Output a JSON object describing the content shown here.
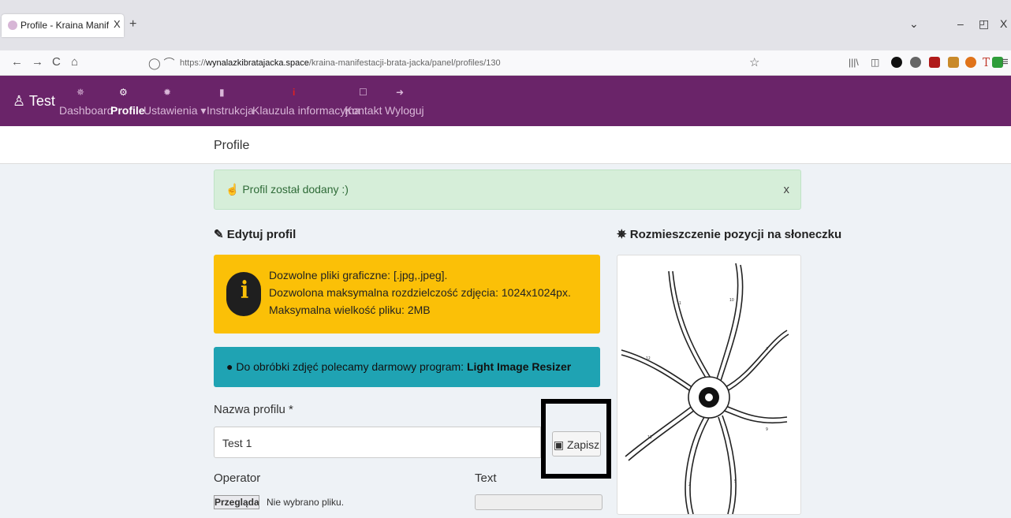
{
  "browser": {
    "tab_title": "Profile - Kraina Manifestacji Bra",
    "tab_close": "X",
    "new_tab": "+",
    "url_prefix": "https://",
    "url_domain": "wynalazkibratajacka.space",
    "url_path": "/kraina-manifestacji-brata-jacka/panel/profiles/130"
  },
  "appnav": {
    "brand": "Test",
    "items": [
      {
        "label": "Dashboard",
        "icon": "sun-icon"
      },
      {
        "label": "Profile",
        "icon": "cogs-icon"
      },
      {
        "label": "Ustawienia ▾",
        "icon": "gear-icon"
      },
      {
        "label": "Instrukcja",
        "icon": "file-icon"
      },
      {
        "label": "Klauzula informacyjna",
        "icon": "info-icon"
      },
      {
        "label": "Kontakt",
        "icon": "envelope-icon"
      },
      {
        "label": "Wyloguj",
        "icon": "logout-icon"
      }
    ]
  },
  "page": {
    "title": "Profile",
    "success_alert": "Profil został dodany :)",
    "success_close": "x",
    "edit_heading": "Edytuj profil",
    "sun_heading": "Rozmieszczenie pozycji na słoneczku",
    "warn_lines": [
      "Dozwolne pliki graficzne: [.jpg,.jpeg].",
      "Dozwolona maksymalna rozdzielczość zdjęcia: 1024x1024px.",
      "Maksymalna wielkość pliku: 2MB"
    ],
    "info_text": "Do obróbki zdjęć polecamy darmowy program:",
    "info_link": "Light Image Resizer",
    "name_label": "Nazwa profilu *",
    "name_value": "Test 1",
    "save_label": "Zapisz",
    "operator_label": "Operator",
    "text_label": "Text",
    "browse_label": "Przeglądaj...",
    "no_file": "Nie wybrano pliku."
  },
  "colors": {
    "nav": "#6a2469",
    "success_bg": "#d6eed9",
    "warn_bg": "#fbc007",
    "info_bg": "#1fa3b3"
  }
}
